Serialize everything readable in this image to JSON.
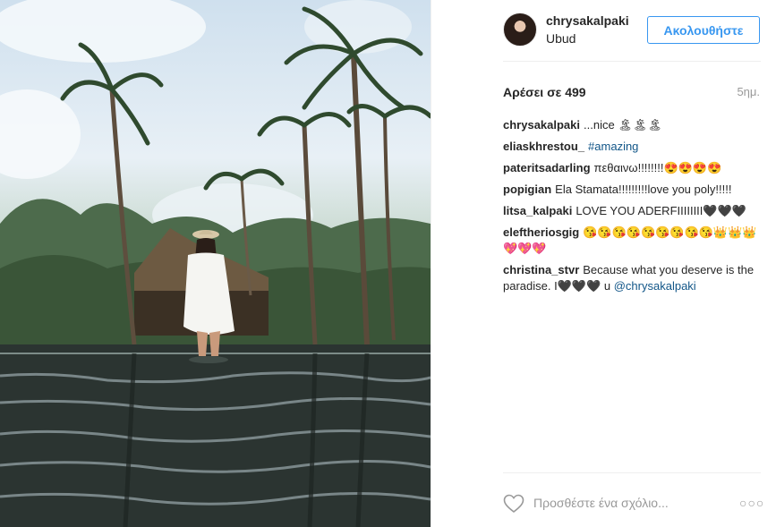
{
  "post": {
    "username": "chrysakalpaki",
    "location": "Ubud",
    "follow_label": "Ακολουθήστε",
    "likes_text": "Αρέσει σε 499",
    "time_ago": "5ημ.",
    "comments": [
      {
        "user": "chrysakalpaki",
        "text": "...nice 🏝🏝🏝"
      },
      {
        "user": "eliaskhrestou_",
        "text": "",
        "link": "#amazing"
      },
      {
        "user": "pateritsadarling",
        "text": "πεθαινω!!!!!!!!😍😍😍😍"
      },
      {
        "user": "popigian",
        "text": "Ela Stamata!!!!!!!!!love you poly!!!!!"
      },
      {
        "user": "litsa_kalpaki",
        "text": "LOVE YOU ADERFIIIIIIII🖤🖤🖤"
      },
      {
        "user": "eleftheriosgig",
        "text": "😘😘😘😘😘😘😘😘😘👑👑👑💖💖💖"
      },
      {
        "user": "christina_stvr",
        "text": "Because what you deserve is the paradise. I🖤🖤🖤 u",
        "link": "@chrysakalpaki"
      }
    ],
    "comment_placeholder": "Προσθέστε ένα σχόλιο...",
    "more_label": "○○○"
  },
  "icons": {
    "heart": "heart-outline-icon",
    "more": "more-options-icon"
  },
  "colors": {
    "accent": "#3897f0",
    "text": "#262626",
    "muted": "#999999",
    "link": "#125688"
  }
}
